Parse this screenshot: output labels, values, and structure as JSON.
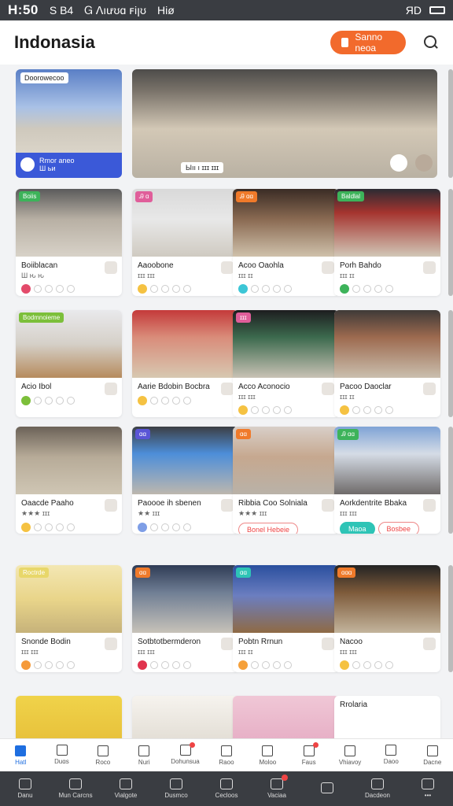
{
  "status": {
    "time": "H:50",
    "carrier": "Ѕ B4",
    "center": "Ꮐ ꓥıưʊɑ ꜰiꞁʊ",
    "label": "Hiø",
    "battery": "ЯD"
  },
  "header": {
    "title": "Indonasia",
    "cta_label": "Sanno neoa"
  },
  "hero": {
    "small_tag": "Doorowecoo",
    "small_strip_line1": "Rmor aneo",
    "small_strip_line2": "Ш ьи",
    "big_caption": "Ыıı ı ɪɪɪ ɪɪɪ"
  },
  "cards": [
    {
      "badge": "Boiis",
      "badge_color": "#3db35a",
      "name": "Boiiblacan",
      "sub": "Ш ԋ ԋ",
      "dot": "#e34a6a",
      "img": "linear-gradient(180deg,#5b5b5b,#b8b0a4 45%,#d8d2c8)"
    },
    {
      "badge": "Ꭿ ɑ",
      "badge_color": "#e05e9a",
      "name": "Aaoobone",
      "sub": "ɪɪɪ ɪɪɪ",
      "dot": "#f5c242",
      "img": "linear-gradient(180deg,#d9d9d9,#e8e8e8 45%,#cfcac1)"
    },
    {
      "badge": "Ꭿ ɑɑ",
      "badge_color": "#f07a2a",
      "name": "Acoo Oaohla",
      "sub": "ɪɪɪ ɪɪ",
      "dot": "#3cc6d6",
      "img": "linear-gradient(180deg,#3a2c25,#8a6a52 45%,#cfc1ab)"
    },
    {
      "badge": "Baldlal",
      "badge_color": "#3db35a",
      "name": "Porh Bahdo",
      "sub": "ɪɪɪ ɪɪ",
      "dot": "#3db35a",
      "img": "linear-gradient(180deg,#2b2b33,#a5342f 35%,#d1c7b7)"
    },
    {
      "badge": "Bodmnoieme",
      "badge_color": "#7cbf3a",
      "name": "Acio Ibol",
      "sub": "",
      "dot": "#7cbf3a",
      "img": "linear-gradient(180deg,#e9e9ec,#d5d0c8 50%,#b68b5d)"
    },
    {
      "badge": "",
      "badge_color": "#e05e9a",
      "name": "Aarie Bdobin Bocbra",
      "sub": "",
      "dot": "#f5c242",
      "img": "linear-gradient(180deg,#c43a3a,#d98c7a 40%,#d7c8b1)"
    },
    {
      "badge": "ɪɪɪ",
      "badge_color": "#e05e9a",
      "name": "Acco Aconocio",
      "sub": "ɪɪɪ ɪɪɪ",
      "dot": "#f5c242",
      "img": "linear-gradient(180deg,#1d1d1f,#3c6a4e 40%,#c9c2b5)"
    },
    {
      "badge": "",
      "badge_color": "#e05e9a",
      "name": "Pacoo Daoclar",
      "sub": "ɪɪɪ ɪɪ",
      "dot": "#f5c242",
      "img": "linear-gradient(180deg,#3f3a38,#9d6a4f 40%,#cabfae)"
    },
    {
      "badge": "",
      "badge_color": "#f07a2a",
      "name": "Oaacde Paaho",
      "sub": "★★★ ɪɪɪ",
      "dot": "#f5c242",
      "img": "linear-gradient(180deg,#6b6258,#b7ab98 45%,#cfc6b4)"
    },
    {
      "badge": "ɑɑ",
      "badge_color": "#5a55d6",
      "name": "Paoooe ih sbenen",
      "sub": "★★ ɪɪɪ",
      "dot": "#7e9ee6",
      "img": "linear-gradient(180deg,#3c3f44,#4d8ed9 40%,#bdb7ae)"
    },
    {
      "badge": "ɑɑ",
      "badge_color": "#f07a2a",
      "name": "Ribbia Coo Solniala",
      "sub": "★★★ ɪɪɪ",
      "dot": "#5ab2e6",
      "img": "linear-gradient(180deg,#d8cfc8,#c6a88f 45%,#b9b2a8)",
      "pill": "Bonel Hebeie",
      "pill_color": "#fff",
      "pill_text": "#e44"
    },
    {
      "badge": "Ꭿ ɑɑ",
      "badge_color": "#3db35a",
      "name": "Aorkdentrite Bbaka",
      "sub": "ɪɪɪ ɪɪɪ",
      "dot": "#2ec4b6",
      "img": "linear-gradient(180deg,#7fa3d6,#d5dce6 40%,#6f6b6a)",
      "pill": "Maoa",
      "pill_color": "#2ec4b6",
      "pill_text": "#fff",
      "pill2": "Bosbee"
    },
    {
      "badge": "Roctrde",
      "badge_color": "#e8d76a",
      "name": "Snonde Bodin",
      "sub": "ɪɪɪ ɪɪɪ",
      "dot": "#f59a3a",
      "img": "linear-gradient(180deg,#f3e7b3,#e9d58a 50%,#c6b27a)"
    },
    {
      "badge": "ɑɑ",
      "badge_color": "#f07a2a",
      "name": "Sotbtotbermderon",
      "sub": "ɪɪɪ ɪɪɪ",
      "dot": "#e0334d",
      "img": "linear-gradient(180deg,#2f3b55,#6f7e94 40%,#c7c2b9)"
    },
    {
      "badge": "ɑɑ",
      "badge_color": "#2ec4b6",
      "name": "Pobtn Rrnun",
      "sub": "ɪɪɪ ɪɪ",
      "dot": "#f5a03a",
      "img": "linear-gradient(180deg,#2a4f9e,#6b7ec0 45%,#8f6a44)"
    },
    {
      "badge": "ɑɑɑ",
      "badge_color": "#f07a2a",
      "name": "Nacoo",
      "sub": "ɪɪɪ ɪɪɪ",
      "dot": "#f5c242",
      "img": "linear-gradient(180deg,#232323,#7d5a3a 40%,#c3b49c)"
    }
  ],
  "bottom_row": [
    {
      "label": "",
      "img": "linear-gradient(180deg,#f0d34a,#e7c03a)"
    },
    {
      "label": "",
      "img": "linear-gradient(180deg,#f6f3ee,#e2ddd4)"
    },
    {
      "label": "",
      "img": "linear-gradient(180deg,#f0c7d6,#e6aec5)"
    },
    {
      "label": "Rrolaria",
      "img": "#fff"
    }
  ],
  "tabbar": [
    {
      "label": "Hatl",
      "active": true
    },
    {
      "label": "Ꭰuɑs",
      "active": false
    },
    {
      "label": "Roco",
      "active": false
    },
    {
      "label": "Nuri",
      "active": false
    },
    {
      "label": "Ꭰohunsua",
      "active": false,
      "badge": true
    },
    {
      "label": "Raoo",
      "active": false
    },
    {
      "label": "Moloo",
      "active": false
    },
    {
      "label": "Faus",
      "active": false,
      "badge": true
    },
    {
      "label": "Vhiavoy",
      "active": false
    },
    {
      "label": "Ꭰaoo",
      "active": false
    },
    {
      "label": "Dacne",
      "active": false
    }
  ],
  "sysbar": [
    {
      "label": "Danu",
      "badge": false
    },
    {
      "label": "Mun Carcns",
      "badge": false
    },
    {
      "label": "Vialgote",
      "badge": false
    },
    {
      "label": "Dusmco",
      "badge": false
    },
    {
      "label": "Cecloos",
      "badge": false
    },
    {
      "label": "Vaciaa",
      "badge": true
    },
    {
      "label": "",
      "badge": false
    },
    {
      "label": "Dacdeon",
      "badge": false
    },
    {
      "label": "•••",
      "badge": false
    }
  ]
}
